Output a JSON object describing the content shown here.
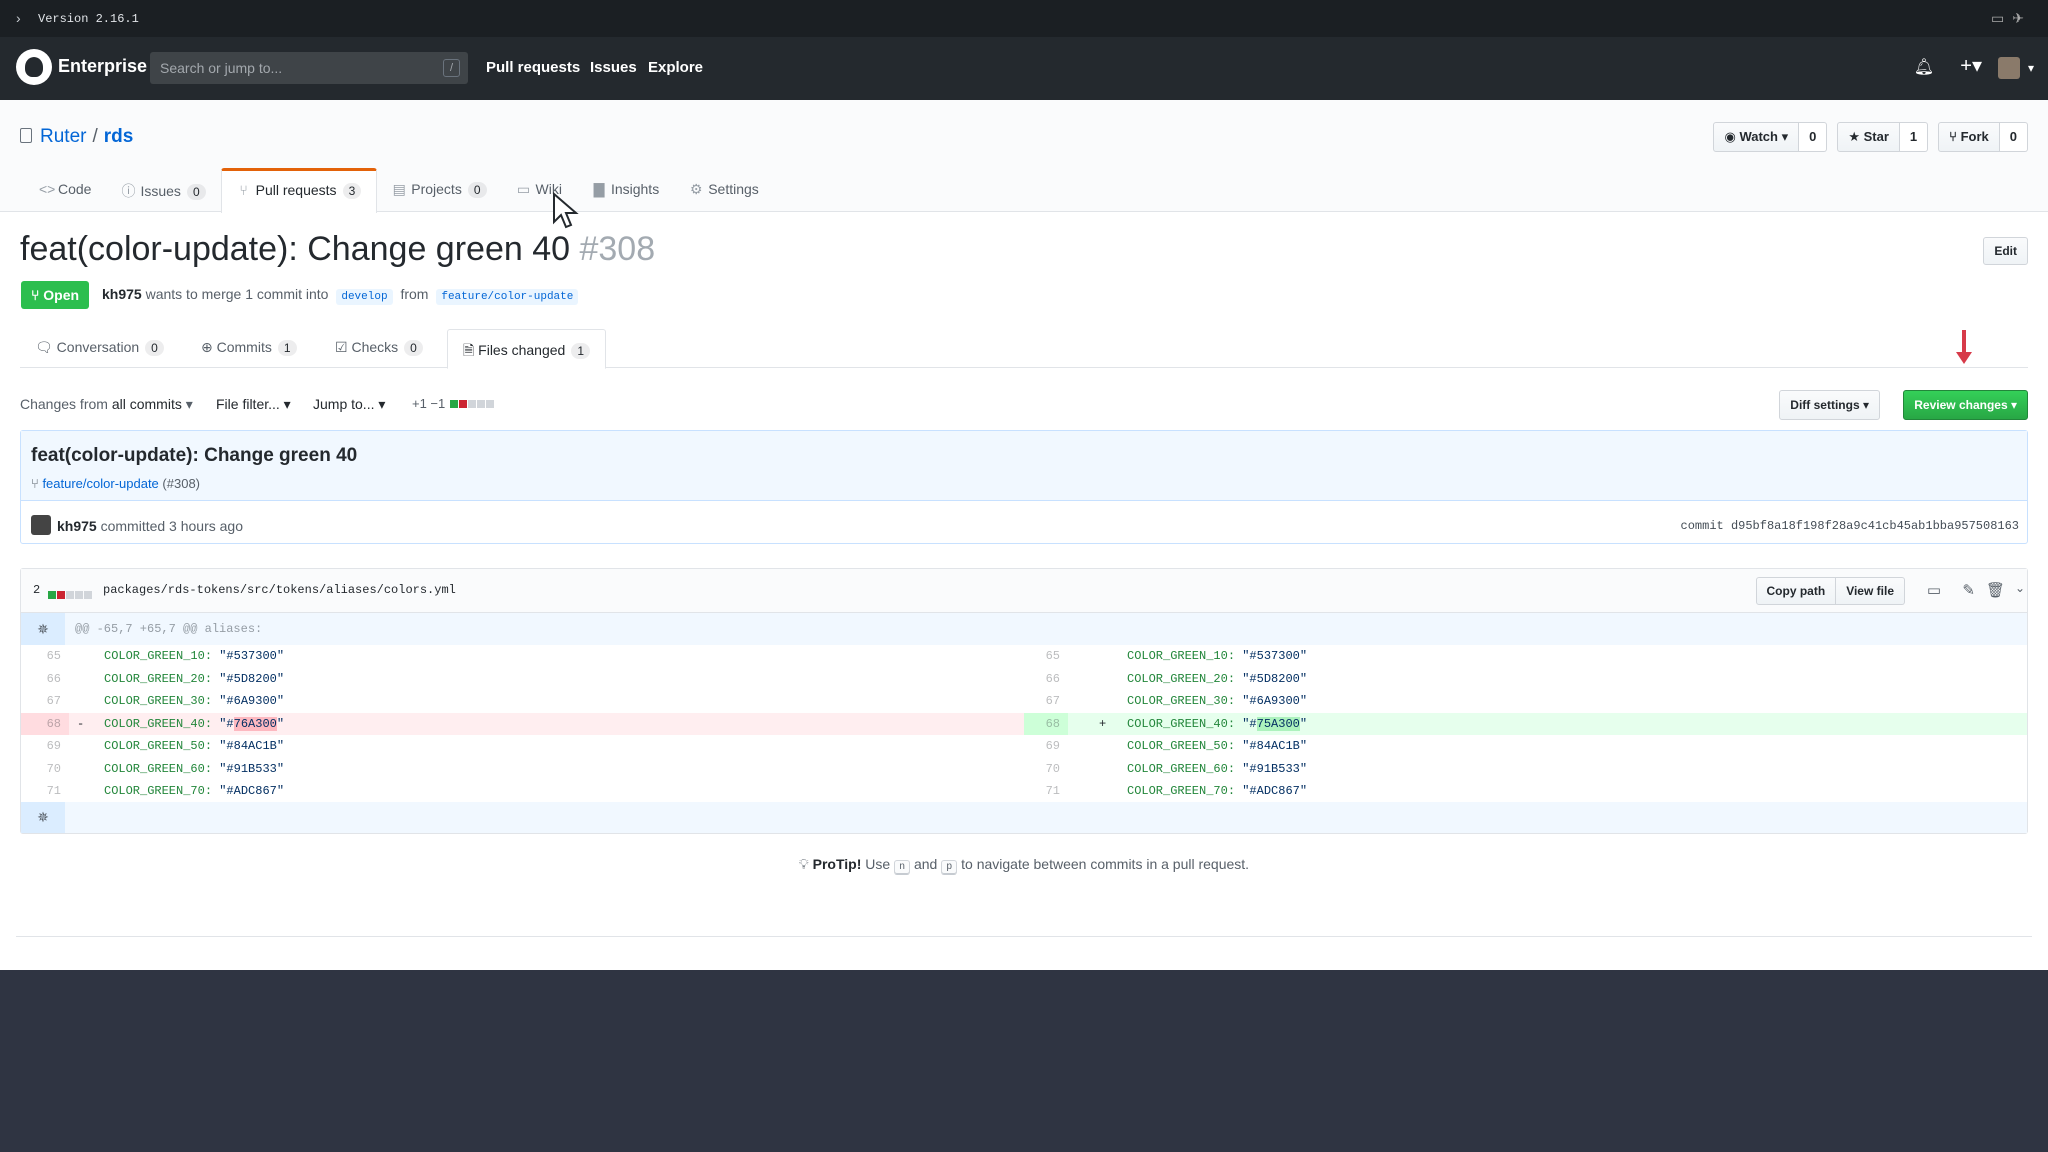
{
  "topbar": {
    "version": "Version 2.16.1"
  },
  "header": {
    "brand": "Enterprise",
    "search_placeholder": "Search or jump to...",
    "search_key": "/",
    "nav": [
      "Pull requests",
      "Issues",
      "Explore"
    ]
  },
  "repo": {
    "owner": "Ruter",
    "name": "rds",
    "watch_label": "Watch",
    "watch_count": "0",
    "star_label": "Star",
    "star_count": "1",
    "fork_label": "Fork",
    "fork_count": "0",
    "tabs": [
      {
        "label": "Code",
        "count": ""
      },
      {
        "label": "Issues",
        "count": "0"
      },
      {
        "label": "Pull requests",
        "count": "3"
      },
      {
        "label": "Projects",
        "count": "0"
      },
      {
        "label": "Wiki",
        "count": ""
      },
      {
        "label": "Insights",
        "count": ""
      },
      {
        "label": "Settings",
        "count": ""
      }
    ]
  },
  "pr": {
    "title": "feat(color-update): Change green 40",
    "number": "#308",
    "edit_label": "Edit",
    "state": "Open",
    "author": "kh975",
    "meta_text": "wants to merge 1 commit into",
    "base": "develop",
    "from_text": "from",
    "head": "feature/color-update",
    "tabs": [
      {
        "label": "Conversation",
        "count": "0"
      },
      {
        "label": "Commits",
        "count": "1"
      },
      {
        "label": "Checks",
        "count": "0"
      },
      {
        "label": "Files changed",
        "count": "1"
      }
    ]
  },
  "toolbar": {
    "changes_prefix": "Changes from",
    "changes_value": "all commits",
    "file_filter": "File filter...",
    "jump_to": "Jump to...",
    "diffstat": "+1 −1",
    "diff_settings": "Diff settings",
    "review_changes": "Review changes"
  },
  "commit": {
    "title": "feat(color-update): Change green 40",
    "branch": "feature/color-update",
    "pr_ref": "(#308)",
    "author": "kh975",
    "when": "committed 3 hours ago",
    "sha_label": "commit",
    "sha": "d95bf8a18f198f28a9c41cb45ab1bba957508163"
  },
  "file": {
    "changes": "2",
    "path": "packages/rds-tokens/src/tokens/aliases/colors.yml",
    "copy_path": "Copy path",
    "view_file": "View file",
    "hunk": "@@ -65,7 +65,7 @@ aliases:",
    "lines": [
      {
        "old": "65",
        "new": "65",
        "key": "COLOR_GREEN_10:",
        "oldval": "\"#537300\"",
        "newval": "\"#537300\""
      },
      {
        "old": "66",
        "new": "66",
        "key": "COLOR_GREEN_20:",
        "oldval": "\"#5D8200\"",
        "newval": "\"#5D8200\""
      },
      {
        "old": "67",
        "new": "67",
        "key": "COLOR_GREEN_30:",
        "oldval": "\"#6A9300\"",
        "newval": "\"#6A9300\""
      },
      {
        "old": "68",
        "new": "68",
        "key": "COLOR_GREEN_40:",
        "oldpre": "\"#",
        "oldhl": "76A300",
        "oldpost": "\"",
        "newpre": "\"#",
        "newhl": "75A300",
        "newpost": "\""
      },
      {
        "old": "69",
        "new": "69",
        "key": "COLOR_GREEN_50:",
        "oldval": "\"#84AC1B\"",
        "newval": "\"#84AC1B\""
      },
      {
        "old": "70",
        "new": "70",
        "key": "COLOR_GREEN_60:",
        "oldval": "\"#91B533\"",
        "newval": "\"#91B533\""
      },
      {
        "old": "71",
        "new": "71",
        "key": "COLOR_GREEN_70:",
        "oldval": "\"#ADC867\"",
        "newval": "\"#ADC867\""
      }
    ]
  },
  "protip": {
    "label": "ProTip!",
    "use": "Use",
    "key_n": "n",
    "and": "and",
    "key_p": "p",
    "rest": "to navigate between commits in a pull request."
  },
  "colors": {
    "accent": "#0366d6",
    "open_green": "#2cbe4e",
    "review_green": "#28a745",
    "del_red": "#d73a49"
  }
}
